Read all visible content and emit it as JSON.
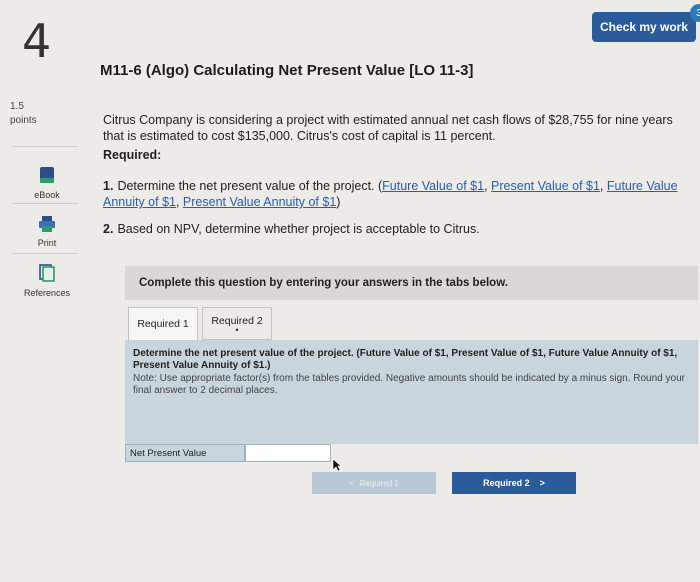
{
  "question_number": "4",
  "check_button": "Check my work",
  "badge_count": "3",
  "points": {
    "value": "1.5",
    "label": "points"
  },
  "side": {
    "ebook": "eBook",
    "print": "Print",
    "references": "References"
  },
  "title": "M11-6 (Algo) Calculating Net Present Value [LO 11-3]",
  "problem_text": "Citrus Company is considering a project with estimated annual net cash flows of $28,755 for nine years that is estimated to cost $135,000. Citrus's cost of capital is 11 percent.",
  "required_label": "Required:",
  "items": [
    {
      "num": "1.",
      "text": "Determine the net present value of the project. (",
      "links": [
        "Future Value of $1",
        "Present Value of $1",
        "Future Value Annuity of $1",
        "Present Value Annuity of $1"
      ],
      "close": ")"
    },
    {
      "num": "2.",
      "text": "Based on NPV, determine whether project is acceptable to Citrus."
    }
  ],
  "complete_prompt": "Complete this question by entering your answers in the tabs below.",
  "tabs": [
    {
      "label": "Required 1"
    },
    {
      "label": "Required 2"
    }
  ],
  "panel": {
    "question": "Determine the net present value of the project. (Future Value of $1, Present Value of $1, Future Value Annuity of $1, Present Value Annuity of $1.)",
    "note": "Note: Use appropriate factor(s) from the tables provided. Negative amounts should be indicated by a minus sign. Round your final answer to 2 decimal places."
  },
  "answer": {
    "label": "Net Present Value",
    "value": ""
  },
  "nav": {
    "prev_label": "Required 1",
    "next_label": "Required 2"
  }
}
